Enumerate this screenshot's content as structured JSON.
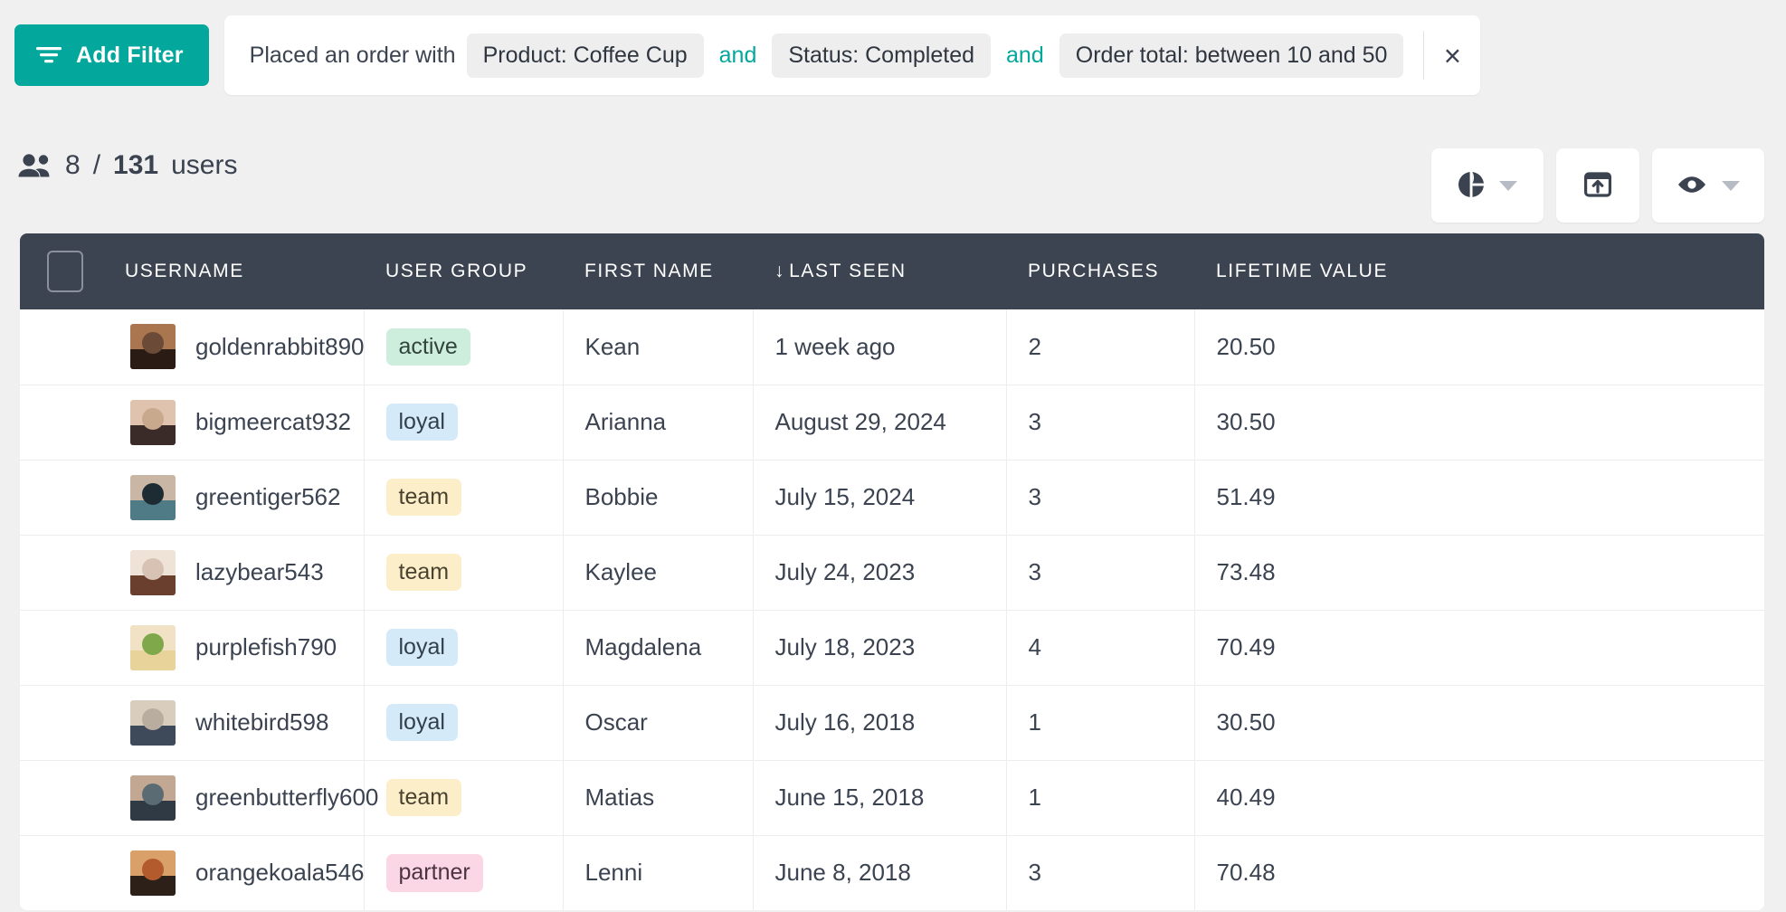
{
  "toolbar": {
    "add_filter_label": "Add Filter",
    "add_filter_icon": "filter-icon",
    "accent_color": "#03A79B"
  },
  "filter_expression": {
    "lead_text": "Placed an order with",
    "conjunction": "and",
    "pills": [
      "Product: Coffee Cup",
      "Status: Completed",
      "Order total: between 10 and 50"
    ],
    "close_label": "×"
  },
  "meta": {
    "people_icon": "people-icon",
    "count_shown": "8",
    "separator": "/",
    "count_total": "131",
    "unit_label": "users"
  },
  "actions": [
    {
      "name": "chart-button",
      "icon": "pie-chart-icon",
      "has_caret": true
    },
    {
      "name": "export-button",
      "icon": "export-box-icon",
      "has_caret": false
    },
    {
      "name": "visibility-button",
      "icon": "eye-icon",
      "has_caret": true
    }
  ],
  "table": {
    "select_all_checkbox": "unchecked",
    "sort_indicator": "↓",
    "sorted_column": "LAST SEEN",
    "columns": [
      "USERNAME",
      "USER GROUP",
      "FIRST NAME",
      "LAST SEEN",
      "PURCHASES",
      "LIFETIME VALUE"
    ],
    "rows": [
      {
        "username": "goldenrabbit890",
        "group": "active",
        "first_name": "Kean",
        "last_seen": "1 week ago",
        "purchases": "2",
        "lifetime_value": "20.50"
      },
      {
        "username": "bigmeercat932",
        "group": "loyal",
        "first_name": "Arianna",
        "last_seen": "August 29, 2024",
        "purchases": "3",
        "lifetime_value": "30.50"
      },
      {
        "username": "greentiger562",
        "group": "team",
        "first_name": "Bobbie",
        "last_seen": "July 15, 2024",
        "purchases": "3",
        "lifetime_value": "51.49"
      },
      {
        "username": "lazybear543",
        "group": "team",
        "first_name": "Kaylee",
        "last_seen": "July 24, 2023",
        "purchases": "3",
        "lifetime_value": "73.48"
      },
      {
        "username": "purplefish790",
        "group": "loyal",
        "first_name": "Magdalena",
        "last_seen": "July 18, 2023",
        "purchases": "4",
        "lifetime_value": "70.49"
      },
      {
        "username": "whitebird598",
        "group": "loyal",
        "first_name": "Oscar",
        "last_seen": "July 16, 2018",
        "purchases": "1",
        "lifetime_value": "30.50"
      },
      {
        "username": "greenbutterfly600",
        "group": "team",
        "first_name": "Matias",
        "last_seen": "June 15, 2018",
        "purchases": "1",
        "lifetime_value": "40.49"
      },
      {
        "username": "orangekoala546",
        "group": "partner",
        "first_name": "Lenni",
        "last_seen": "June 8, 2018",
        "purchases": "3",
        "lifetime_value": "70.48"
      }
    ]
  },
  "badge_colors": {
    "active": "#cdeedd",
    "loyal": "#d5eaf9",
    "team": "#fbeec9",
    "partner": "#fbd7e6"
  },
  "avatar_palettes": [
    [
      "#6b4b38",
      "#2a1c14",
      "#a9764f"
    ],
    [
      "#c9a98d",
      "#3a2b28",
      "#e0c3ae"
    ],
    [
      "#1d2b33",
      "#4f7b86",
      "#c9b6a4"
    ],
    [
      "#d7c2b4",
      "#6b3f2e",
      "#efe2d6"
    ],
    [
      "#7fa84a",
      "#e8d49a",
      "#f2e2c5"
    ],
    [
      "#b9ada0",
      "#3e4a5a",
      "#d9cdbe"
    ],
    [
      "#5a6b74",
      "#2f3a44",
      "#c2a893"
    ],
    [
      "#b35b2c",
      "#2c2019",
      "#d9a06a"
    ]
  ]
}
